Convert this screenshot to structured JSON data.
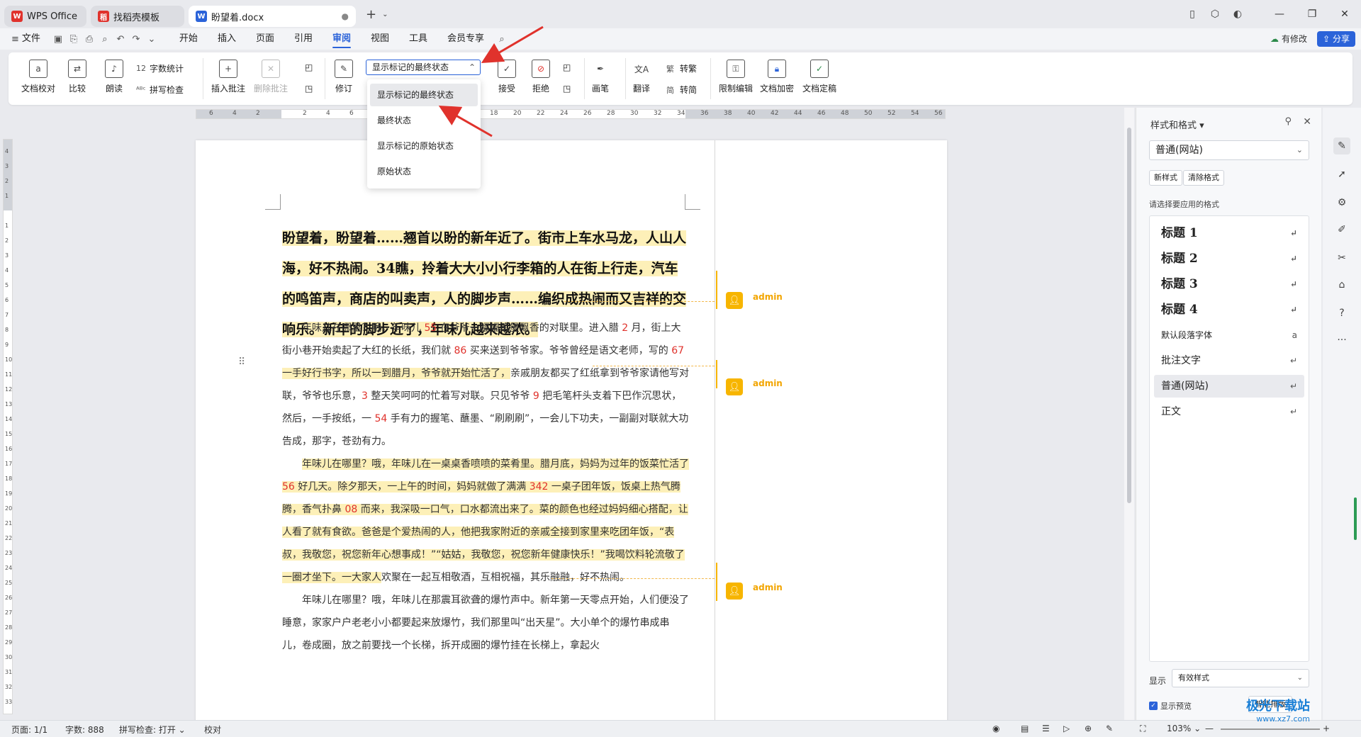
{
  "titlebar": {
    "tabs": [
      {
        "label": "WPS Office",
        "logo": "W",
        "color": "#e0322c"
      },
      {
        "label": "找稻壳模板",
        "logo": "稻",
        "color": "#e0322c"
      },
      {
        "label": "盼望着.docx",
        "logo": "W",
        "color": "#2b63d9"
      }
    ],
    "new_tab": "+",
    "window_icons": [
      "layout-icon",
      "cube-icon",
      "avatar"
    ],
    "window_buttons": [
      "minimize",
      "maximize",
      "close"
    ]
  },
  "menubar": {
    "file": "文件",
    "items": [
      "开始",
      "插入",
      "页面",
      "引用",
      "审阅",
      "视图",
      "工具",
      "会员专享"
    ],
    "active": "审阅",
    "has_changes": "有修改",
    "share": "分享"
  },
  "ribbon": {
    "doc_proof": "文档校对",
    "compare": "比较",
    "read_aloud": "朗读",
    "word_count": "字数统计",
    "spell_check": "拼写检查",
    "insert_comment": "插入批注",
    "delete_comment": "删除批注",
    "revise": "修订",
    "markup_display": "显示标记的最终状态",
    "accept": "接受",
    "reject": "拒绝",
    "pen": "画笔",
    "translate": "翻译",
    "to_traditional": "转繁",
    "to_simplified": "转简",
    "restrict_edit": "限制编辑",
    "encrypt": "文档加密",
    "finalize": "文档定稿"
  },
  "dropdown": {
    "options": [
      "显示标记的最终状态",
      "最终状态",
      "显示标记的原始状态",
      "原始状态"
    ],
    "selected": 0
  },
  "ruler": {
    "ticks": [
      "6",
      "4",
      "2",
      "",
      "2",
      "4",
      "6",
      "8",
      "10",
      "12",
      "14",
      "16",
      "18",
      "20",
      "22",
      "24",
      "26",
      "28",
      "30",
      "32",
      "34",
      "36",
      "38",
      "40",
      "42",
      "44",
      "46",
      "48",
      "50",
      "52",
      "54",
      "56"
    ],
    "vticks": [
      "4",
      "3",
      "2",
      "1",
      "",
      "1",
      "2",
      "3",
      "4",
      "5",
      "6",
      "7",
      "8",
      "9",
      "10",
      "11",
      "12",
      "13",
      "14",
      "15",
      "16",
      "17",
      "18",
      "19",
      "20",
      "21",
      "22",
      "23",
      "24",
      "25",
      "26",
      "27",
      "28",
      "29",
      "30",
      "31",
      "32",
      "33"
    ]
  },
  "document": {
    "title": "盼望着，盼望着……翘首以盼的新年近了。街市上车水马龙，人山人海，好不热闹。34瞧，拎着大大小小行李箱的人在街上行走，汽车的鸣笛声，商店的叫卖声，人的脚步声……编织成热闹而又吉祥的交响乐。新年的脚步近了，年味儿越来越浓。",
    "p1": [
      {
        "t": "年味儿在哪里？哦，年味儿 "
      },
      {
        "t": "55",
        "n": true
      },
      {
        "t": " 在爷爷一幅幅笔墨飘香的对联里。进入腊 "
      },
      {
        "t": "2",
        "n": true
      },
      {
        "t": " 月，街上大街小巷开始卖起了大红的长纸，我们就 "
      },
      {
        "t": "86",
        "n": true
      },
      {
        "t": " 买来送到爷爷家。爷爷曾经是语文老师，写的 "
      },
      {
        "t": "67",
        "n": true
      },
      {
        "t": " 一",
        "h": true
      },
      {
        "t": "手好行书字，所以一到腊月，爷爷就开始忙活了，",
        "h": true
      },
      {
        "t": "亲戚朋友都买了红纸拿到爷爷家请他写对联，爷爷也乐意，"
      },
      {
        "t": "3",
        "n": true
      },
      {
        "t": " 整天笑呵呵的忙着写对联。只见爷爷 "
      },
      {
        "t": "9",
        "n": true
      },
      {
        "t": " 把毛笔杆头支着下巴作沉思状，然后，一手按纸，一 "
      },
      {
        "t": "54",
        "n": true
      },
      {
        "t": " 手有力的握笔、蘸墨、“刷刷刷”，一会儿下功夫，一副副对联就大功告成，那字，苍劲有力。"
      }
    ],
    "p2": [
      {
        "t": "年味儿在哪里？哦，年味儿在一桌桌香喷喷的菜肴里。腊月底，妈妈为过年的饭菜忙活了 ",
        "h": true
      },
      {
        "t": "56",
        "n": true,
        "h": true
      },
      {
        "t": " 好几天。除夕那天，一上午的时间，妈妈就做了满满 ",
        "h": true
      },
      {
        "t": "342",
        "n": true,
        "h": true
      },
      {
        "t": " 一桌子团年饭，饭桌上热气腾腾，香气扑鼻 ",
        "h": true
      },
      {
        "t": "08",
        "n": true,
        "h": true
      },
      {
        "t": " 而来，我深吸一口气，口水都流出来了。菜的颜色也经过妈妈细心搭配，让人看了就有食欲。爸爸是个爱热闹的人，他把我家附近的亲戚全接到家里来吃团年饭，“表叔，我敬您，祝您新年心想事成！”“姑姑，我敬您，祝您新年健康快乐！”我喝饮料轮流敬了一圈才坐下。一大家人",
        "h": true
      },
      {
        "t": "欢聚在一起互相敬酒，互相祝福，其乐融融，好不热闹。"
      }
    ],
    "p3": "年味儿在哪里？哦，年味儿在那震耳欲聋的爆竹声中。新年第一天零点开始，人们便没了睡意，家家户户老老小小都要起来放爆竹，我们那里叫“出天星”。大小单个的爆竹串成串儿，卷成圈，放之前要找一个长梯，拆开成圈的爆竹挂在长梯上，拿起火",
    "comment_author": "admin"
  },
  "style_panel": {
    "title": "样式和格式",
    "current": "普通(网站)",
    "new_style": "新样式",
    "clear_format": "清除格式",
    "choose_label": "请选择要应用的格式",
    "styles": [
      {
        "name": "标题  1",
        "type": "h"
      },
      {
        "name": "标题  2",
        "type": "h"
      },
      {
        "name": "标题  3",
        "type": "h"
      },
      {
        "name": "标题  4",
        "type": "h"
      },
      {
        "name": "默认段落字体",
        "type": "small"
      },
      {
        "name": "批注文字",
        "type": "n"
      },
      {
        "name": "普通(网站)",
        "type": "sel"
      },
      {
        "name": "正文",
        "type": "n"
      }
    ],
    "show_label": "显示",
    "show_value": "有效样式",
    "preview_label": "显示预览",
    "smart_layout": "智能排版"
  },
  "statusbar": {
    "page": "页面: 1/1",
    "words": "字数: 888",
    "spell": "拼写检查: 打开",
    "proof": "校对",
    "zoom": "103%"
  },
  "watermark": {
    "line1": "极光下载站",
    "line2": "www.xz7.com"
  },
  "colors": {
    "accent": "#2b63d9",
    "highlight": "#fdf0b8",
    "comment": "#f7b500",
    "number": "#e0322c",
    "arrow": "#e0322c"
  }
}
